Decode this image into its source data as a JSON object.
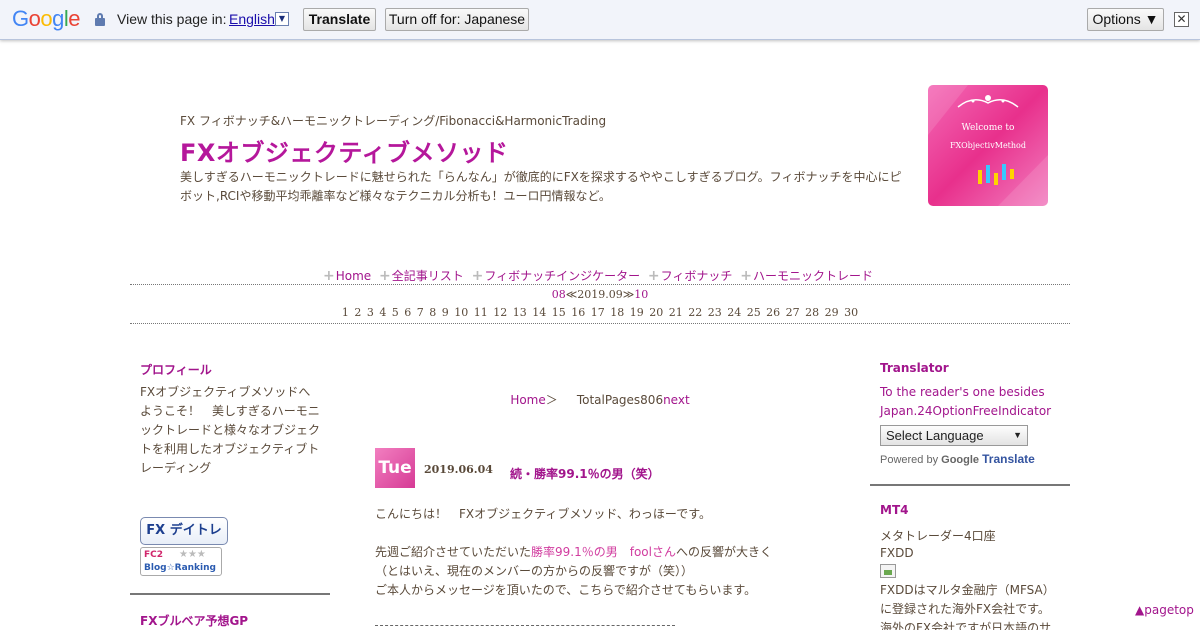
{
  "translate_bar": {
    "logo": "Google",
    "view_text": "View this page in:",
    "language": "English",
    "translate_button": "Translate",
    "turn_off_button": "Turn off for: Japanese",
    "options_button": "Options ▼",
    "close_glyph": "✕"
  },
  "header": {
    "subtitle": "FX フィボナッチ&ハーモニックトレーディング/Fibonacci&HarmonicTrading",
    "title": "FXオブジェクティブメソッド",
    "description": "美しすぎるハーモニックトレードに魅せられた「らんなん」が徹底的にFXを探求するややこしすぎるブログ。フィボナッチを中心にピボット,RCIや移動平均乖離率など様々なテクニカル分析も！ユーロ円情報など。",
    "banner_line1": "Welcome to",
    "banner_line2": "FXObjectivMethod"
  },
  "nav": {
    "items": [
      "Home",
      "全記事リスト",
      "フィボナッチインジケーター",
      "フィボナッチ",
      "ハーモニックトレード"
    ]
  },
  "calendar": {
    "prev": "08",
    "current": "≪2019.09≫",
    "next": "10",
    "days": "1 2 3 4 5 6 7 8 9 10 11 12 13 14 15 16 17 18 19 20 21 22 23 24 25 26 27 28 29 30"
  },
  "left_sidebar": {
    "profile_heading": "プロフィール",
    "profile_text": "FXオブジェクティブメソッドへようこそ！　美しすぎるハーモニックトレードと様々なオブジェクトを利用したオブジェクティブトレーディング",
    "badge_daytrade": "FX デイトレ派",
    "badge_fc2_top": "FC2",
    "badge_fc2_bottom": "Blog☆Ranking",
    "next_heading": "FXブルベア予想GP"
  },
  "main": {
    "pager_home": "Home",
    "pager_sep": "＞",
    "pager_total": "TotalPages806",
    "pager_next": "next",
    "post": {
      "day": "Tue",
      "date": "2019.06.04",
      "title": "続・勝率99.1％の男（笑）",
      "p1": "こんにちは！　FXオブジェクティブメソッド、わっほーです。",
      "p2_before": "先週ご紹介させていただいた",
      "p2_link1": "勝率99.1％の男　foolさん",
      "p2_after": "への反響が大きく",
      "p3": "（とはいえ、現在のメンバーの方からの反響ですが（笑））",
      "p4": "ご本人からメッセージを頂いたので、こちらで紹介させてもらいます。"
    }
  },
  "right_sidebar": {
    "translator_heading": "Translator",
    "translator_text": "To the reader's one besides Japan.24OptionFreeIndicator",
    "select_label": "Select Language",
    "powered_by": "Powered by",
    "google": "Google",
    "translate": "Translate",
    "mt4_heading": "MT4",
    "mt4_line1": "メタトレーダー4口座",
    "mt4_line2": "FXDD",
    "mt4_line3": "FXDDはマルタ金融庁（MFSA）",
    "mt4_line4": "に登録された海外FX会社です。",
    "mt4_line5": "海外のFX会社ですが日本語のサ"
  },
  "pagetop": "▲pagetop",
  "colors": {
    "accent": "#a2158c",
    "title": "#b5179b",
    "text": "#5a4a3a",
    "banner": "#e8308c"
  }
}
